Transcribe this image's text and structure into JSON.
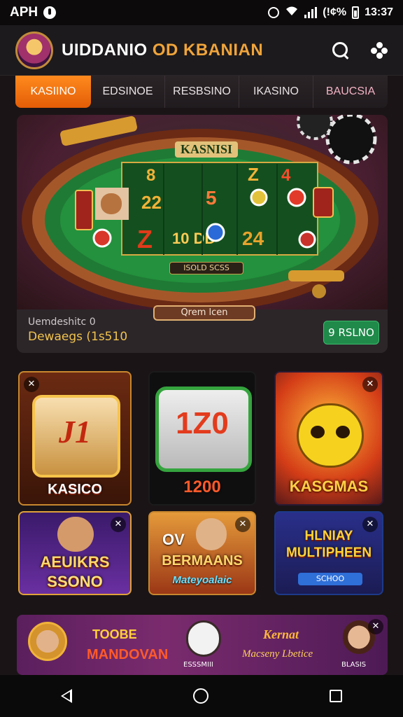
{
  "status_bar": {
    "carrier": "APH",
    "battery_text": "(!¢%",
    "time": "13:37"
  },
  "header": {
    "title_part1": "UIDDANIO",
    "title_part2": "OD KBANIAN",
    "icons": [
      "search-icon",
      "puzzle-icon"
    ]
  },
  "tabs": [
    {
      "label": "KASIINO",
      "active": true
    },
    {
      "label": "EDSINOE",
      "active": false
    },
    {
      "label": "RESBSINO",
      "active": false
    },
    {
      "label": "IKASINO",
      "active": false
    },
    {
      "label": "BAUCSIA",
      "active": false
    }
  ],
  "hero": {
    "table_sign": "KASNISI",
    "center_plate": "ISOLD SCSS",
    "bottom_plate": "Qrem lcen",
    "reels": [
      "8",
      "22",
      "5",
      "Z",
      "4",
      "Z",
      "10 DD",
      "24"
    ],
    "caption_small": "Uemdeshitc 0",
    "caption_large": "Dewaegs (1s510",
    "play_label": "9 RSLNO"
  },
  "games": [
    {
      "title": "KASICO",
      "reel_text": "J1"
    },
    {
      "title": "",
      "reel_text": "1Z0",
      "badge": "1200"
    },
    {
      "title": "KASGMAS",
      "reel_text": ""
    },
    {
      "title": "AEUIKRS",
      "subtitle": "SSONO"
    },
    {
      "title": "BERMAANS",
      "subtitle": "Mateyoalaic",
      "prefix": "OV"
    },
    {
      "title": "HLNIAY MULTIPHEEN",
      "subtitle": "SCHOO"
    }
  ],
  "banner": {
    "items": [
      "TOOBE",
      "MANDOVAN",
      "ESSSMIII",
      "Kernat",
      "Macseny Lbetice",
      "BLASIS"
    ]
  },
  "colors": {
    "accent_orange": "#e8650a",
    "header_bg": "#1c1a1c",
    "tab_bg": "#241f22",
    "play_green": "#1f8a4a",
    "gold": "#f0a43a"
  }
}
